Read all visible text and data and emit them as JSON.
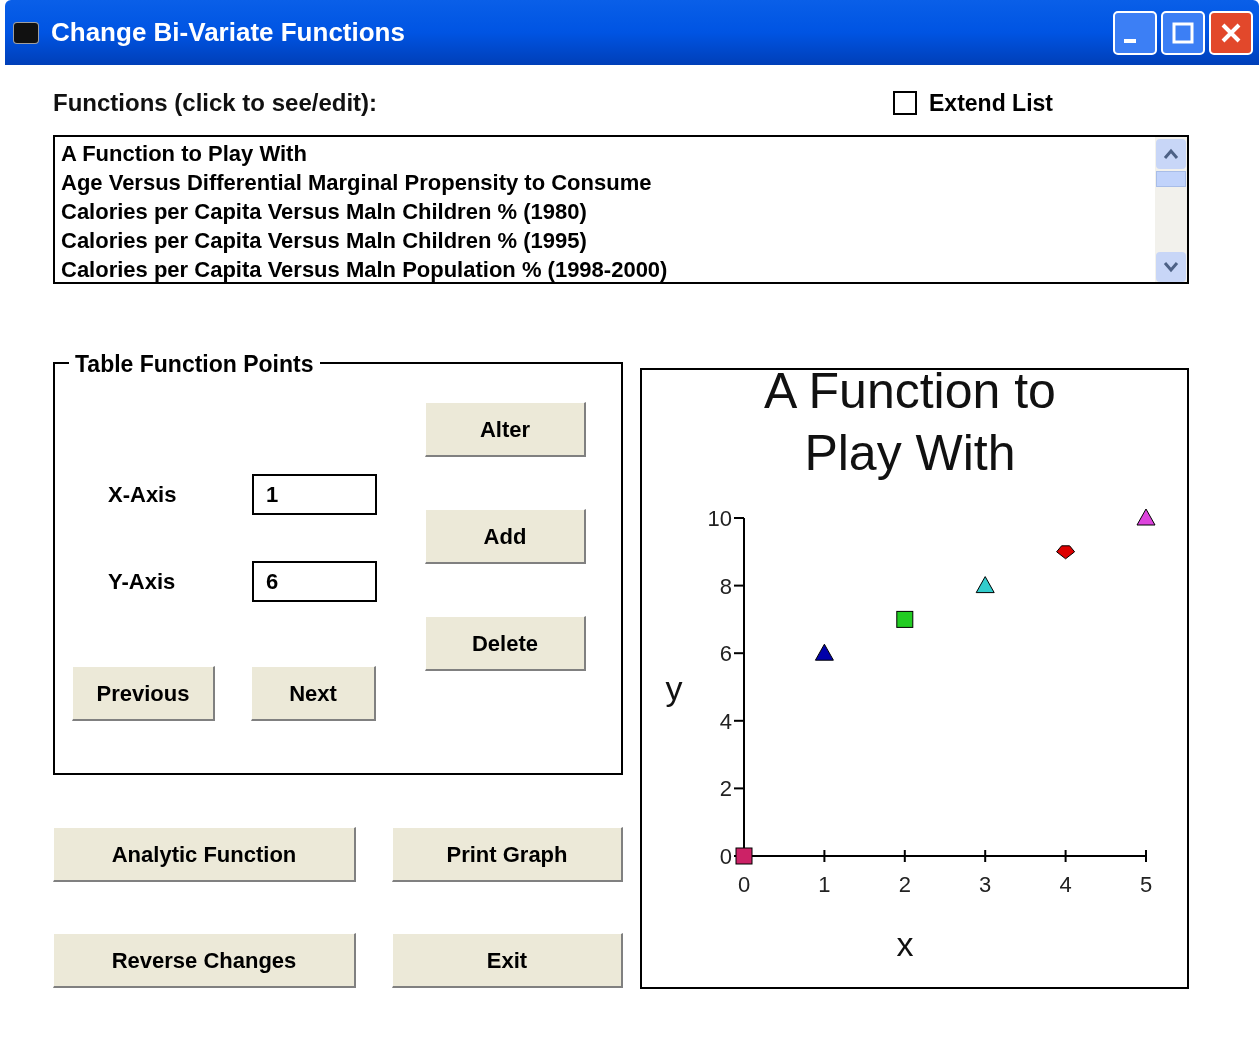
{
  "window": {
    "title": "Change Bi-Variate Functions"
  },
  "functions_label": "Functions (click to see/edit):",
  "extend_list": {
    "label": "Extend List",
    "checked": false
  },
  "functions": [
    {
      "label": "A Function to Play With",
      "selected": false
    },
    {
      "label": "Age Versus Differential Marginal Propensity to Consume",
      "selected": false
    },
    {
      "label": "Calories per Capita Versus Maln Children % (1980)",
      "selected": false
    },
    {
      "label": "Calories per Capita Versus Maln Children % (1995)",
      "selected": false
    },
    {
      "label": "Calories per Capita Versus Maln Population % (1998-2000)",
      "selected": false
    }
  ],
  "table_points": {
    "title": "Table Function Points",
    "x_axis": {
      "label": "X-Axis",
      "value": "1"
    },
    "y_axis": {
      "label": "Y-Axis",
      "value": "6"
    },
    "buttons": {
      "alter": "Alter",
      "add": "Add",
      "delete": "Delete",
      "previous": "Previous",
      "next": "Next"
    }
  },
  "buttons": {
    "analytic": "Analytic Function",
    "print": "Print Graph",
    "reverse": "Reverse Changes",
    "exit": "Exit"
  },
  "graph": {
    "chart_data": {
      "type": "scatter",
      "title": "A Function to Play With",
      "xlabel": "x",
      "ylabel": "y",
      "x": [
        0,
        1,
        2,
        3,
        4,
        5
      ],
      "series": [
        {
          "color": "#cc2266",
          "marker": "square",
          "values": [
            0,
            null,
            null,
            null,
            null,
            null
          ]
        },
        {
          "color": "#0000aa",
          "marker": "triangle",
          "values": [
            null,
            6,
            null,
            null,
            null,
            null
          ]
        },
        {
          "color": "#22cc22",
          "marker": "square",
          "values": [
            null,
            null,
            7,
            null,
            null,
            null
          ]
        },
        {
          "color": "#33cccc",
          "marker": "triangle",
          "values": [
            null,
            null,
            null,
            8,
            null,
            null
          ]
        },
        {
          "color": "#dd0000",
          "marker": "diamond",
          "values": [
            null,
            null,
            null,
            null,
            9,
            null
          ]
        },
        {
          "color": "#dd44dd",
          "marker": "triangle",
          "values": [
            null,
            null,
            null,
            null,
            null,
            10
          ]
        }
      ],
      "xlim": [
        0,
        5
      ],
      "ylim": [
        0,
        10
      ],
      "xticks": [
        0,
        1,
        2,
        3,
        4,
        5
      ],
      "yticks": [
        0,
        2,
        4,
        6,
        8,
        10
      ]
    }
  }
}
